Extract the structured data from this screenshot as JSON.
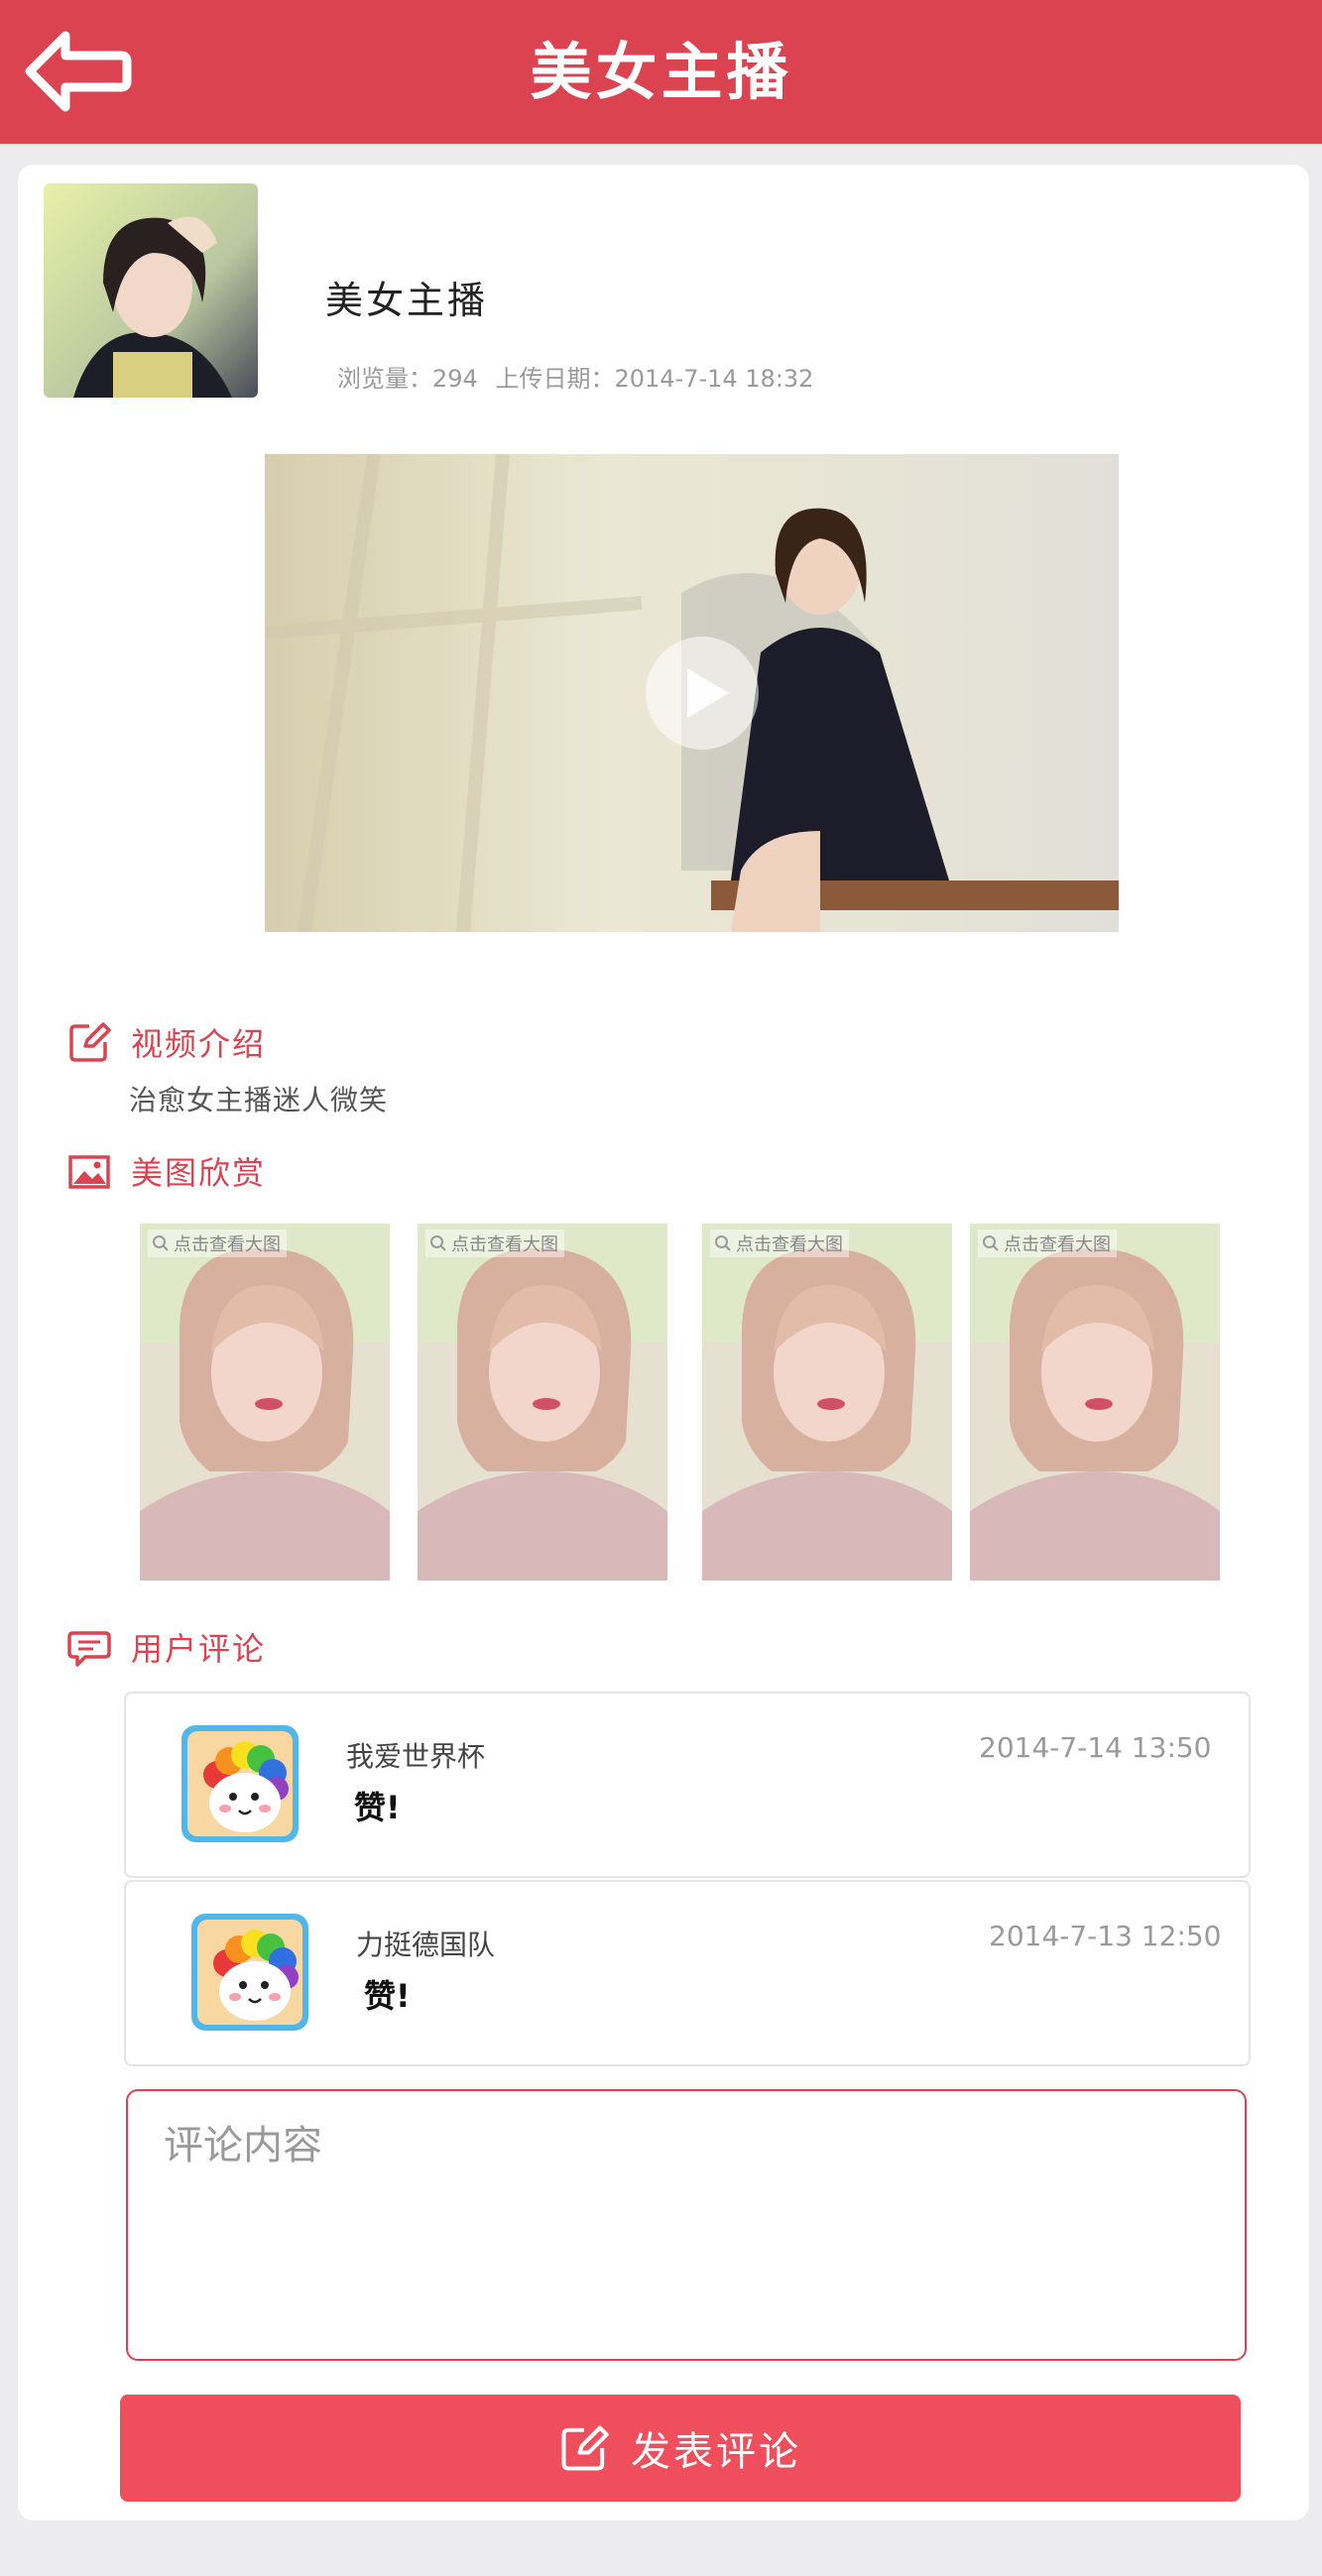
{
  "header": {
    "title": "美女主播",
    "back_icon": "back-arrow-icon"
  },
  "profile": {
    "name": "美女主播",
    "views_label": "浏览量：294",
    "upload_label": "上传日期：2014-7-14  18:32"
  },
  "video": {
    "play_icon": "play-icon"
  },
  "intro": {
    "title": "视频介绍",
    "icon": "edit-icon",
    "text": "治愈女主播迷人微笑"
  },
  "gallery": {
    "title": "美图欣赏",
    "icon": "image-icon",
    "items": [
      {
        "hint": "点击查看大图"
      },
      {
        "hint": "点击查看大图"
      },
      {
        "hint": "点击查看大图"
      },
      {
        "hint": "点击查看大图"
      }
    ]
  },
  "comments": {
    "title": "用户评论",
    "icon": "comment-icon",
    "items": [
      {
        "user": "我爱世界杯",
        "text": "赞!",
        "time": "2014-7-14 13:50"
      },
      {
        "user": "力挺德国队",
        "text": "赞!",
        "time": "2014-7-13 12:50"
      }
    ]
  },
  "comment_form": {
    "placeholder": "评论内容",
    "submit_label": "发表评论",
    "submit_icon": "edit-icon"
  },
  "colors": {
    "accent": "#dc4350",
    "button": "#ef4e5c"
  }
}
